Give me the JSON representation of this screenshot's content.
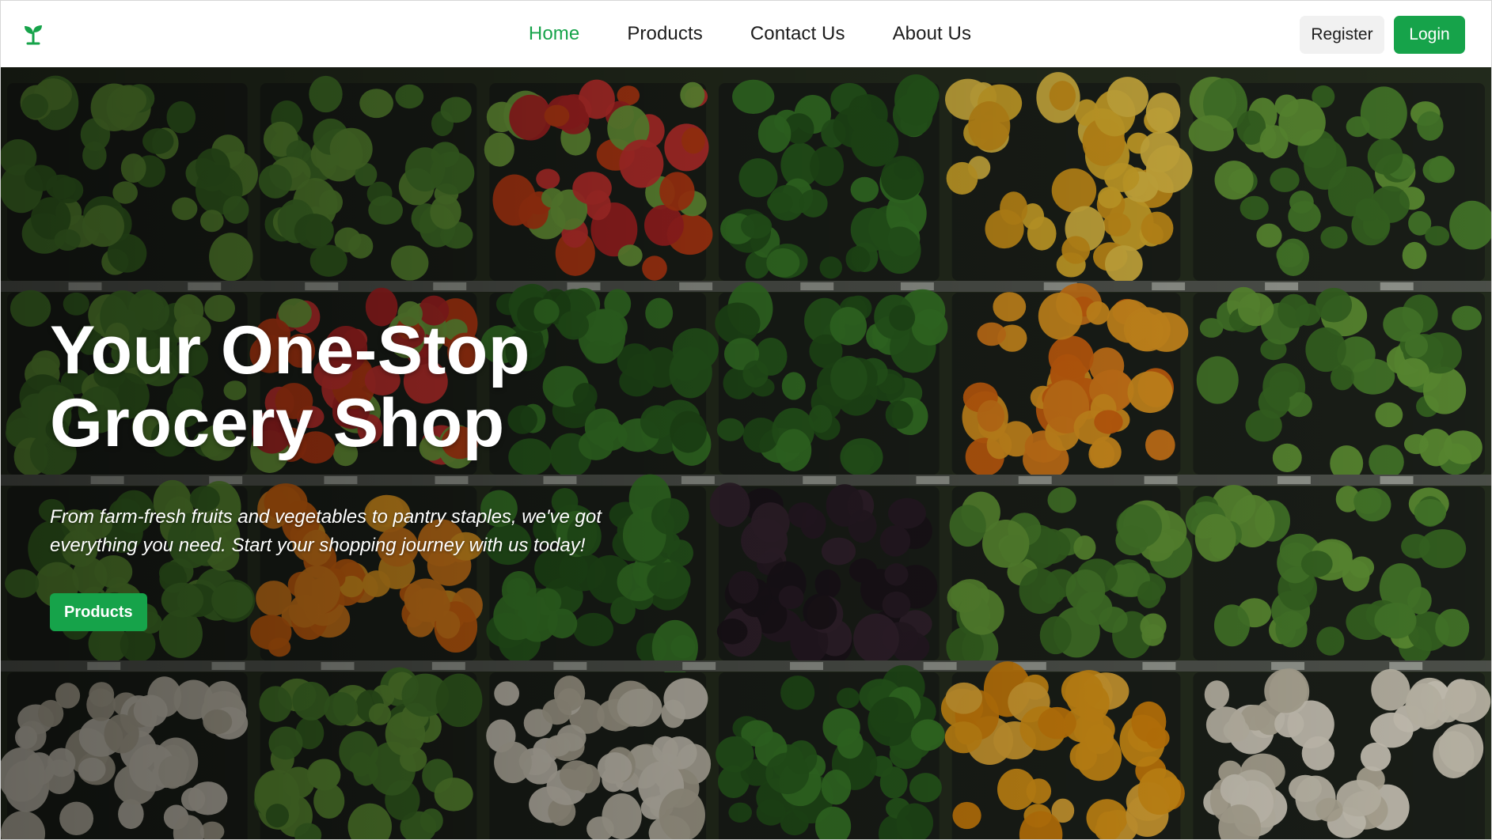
{
  "brand": {
    "logo_icon": "sprout-icon",
    "accent_color": "#16a34a"
  },
  "nav": {
    "links": [
      {
        "label": "Home",
        "active": true
      },
      {
        "label": "Products",
        "active": false
      },
      {
        "label": "Contact Us",
        "active": false
      },
      {
        "label": "About Us",
        "active": false
      }
    ],
    "register_label": "Register",
    "login_label": "Login"
  },
  "hero": {
    "title_line1": "Your One-Stop",
    "title_line2": "Grocery Shop",
    "subtitle": "From farm-fresh fruits and vegetables to pantry staples, we've got everything you need. Start your shopping journey with us today!",
    "cta_label": "Products",
    "background": "grocery-produce-shelves-photo"
  }
}
